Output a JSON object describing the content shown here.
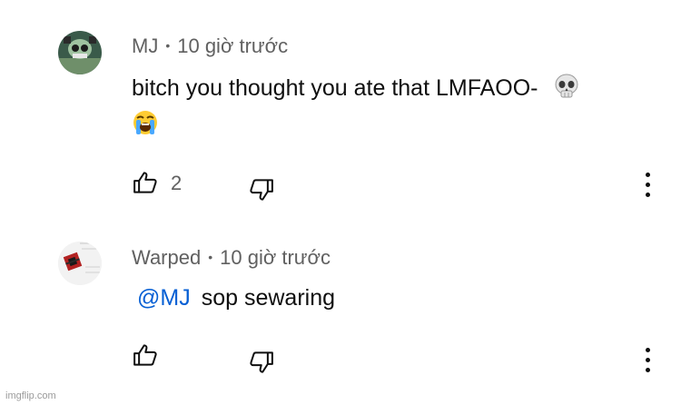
{
  "comments": [
    {
      "author": "MJ",
      "time": "10 giờ trước",
      "line1": "bitch you thought you ate that LMFAOO-",
      "emoji1": "skull-emoji",
      "emoji2": "loudly-crying-emoji",
      "likes": "2"
    },
    {
      "author": "Warped",
      "time": "10 giờ trước",
      "mention": "@MJ",
      "text": "sop sewaring",
      "likes": ""
    }
  ],
  "separator": "•",
  "watermark": "imgflip.com",
  "colors": {
    "meta": "#606060",
    "mention": "#065fd4",
    "text": "#0f0f0f"
  }
}
